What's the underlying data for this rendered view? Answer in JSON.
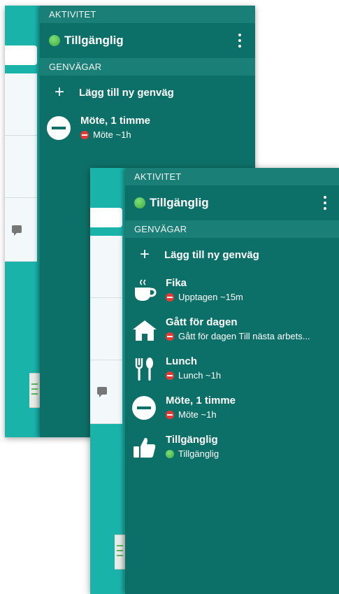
{
  "back": {
    "activity_header": "AKTIVITET",
    "status": "Tillgänglig",
    "shortcuts_header": "GENVÄGAR",
    "add_shortcut": "Lägg till ny genväg",
    "items": [
      {
        "title": "Möte, 1 timme",
        "subtitle": "Möte ~1h",
        "icon": "minus-circle-icon",
        "status_icon": "no-entry-icon"
      }
    ]
  },
  "front": {
    "activity_header": "AKTIVITET",
    "status": "Tillgänglig",
    "shortcuts_header": "GENVÄGAR",
    "add_shortcut": "Lägg till ny genväg",
    "items": [
      {
        "title": "Fika",
        "subtitle": "Upptagen ~15m",
        "icon": "coffee-cup-icon",
        "status_icon": "no-entry-icon"
      },
      {
        "title": "Gått för dagen",
        "subtitle": "Gått för dagen Till nästa arbets...",
        "icon": "house-icon",
        "status_icon": "no-entry-icon"
      },
      {
        "title": "Lunch",
        "subtitle": "Lunch ~1h",
        "icon": "fork-spoon-icon",
        "status_icon": "no-entry-icon"
      },
      {
        "title": "Möte, 1 timme",
        "subtitle": "Möte ~1h",
        "icon": "minus-circle-icon",
        "status_icon": "no-entry-icon"
      },
      {
        "title": "Tillgänglig",
        "subtitle": "Tillgänglig",
        "icon": "thumbs-up-icon",
        "status_icon": "green-dot-icon"
      }
    ]
  },
  "colors": {
    "drawer_bg": "#0d7068",
    "section_header_bg": "#1a7f77",
    "accent_teal": "#1ab3aa",
    "available_green": "#4caf50",
    "busy_red": "#e53935"
  }
}
